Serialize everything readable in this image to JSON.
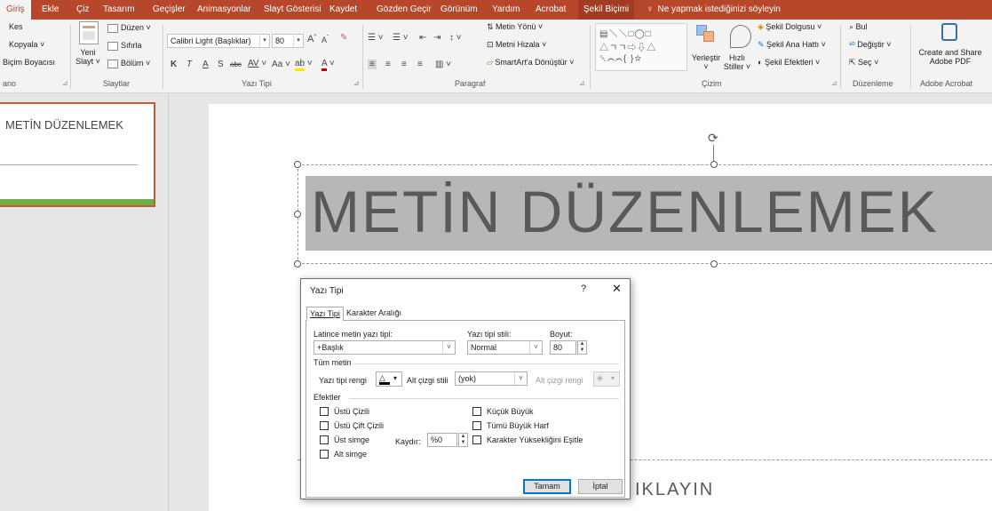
{
  "ribbon_tabs": [
    {
      "label": "Giriş",
      "active": true
    },
    {
      "label": "Ekle"
    },
    {
      "label": "Çiz"
    },
    {
      "label": "Tasarım"
    },
    {
      "label": "Geçişler"
    },
    {
      "label": "Animasyonlar"
    },
    {
      "label": "Slayt Gösterisi"
    },
    {
      "label": "Kaydet"
    },
    {
      "label": "Gözden Geçir"
    },
    {
      "label": "Görünüm"
    },
    {
      "label": "Yardım"
    },
    {
      "label": "Acrobat"
    },
    {
      "label": "Şekil Biçimi",
      "contextual": true
    }
  ],
  "tell_me": "Ne yapmak istediğinizi söyleyin",
  "clipboard": {
    "cut": "Kes",
    "copy": "Kopyala",
    "format_painter": "Biçim Boyacısı",
    "group_label": "ano"
  },
  "slides_group": {
    "new_slide_line1": "Yeni",
    "new_slide_line2": "Slayt",
    "layout": "Düzen",
    "reset": "Sıfırla",
    "section": "Bölüm",
    "group_label": "Slaytlar"
  },
  "font_group": {
    "font_name": "Calibri Light (Başlıklar)",
    "font_size": "80",
    "bold": "K",
    "italic": "T",
    "underline": "A",
    "shadow": "S",
    "strike": "abc",
    "spacing": "AV",
    "case": "Aa",
    "grow": "A",
    "shrink": "A",
    "group_label": "Yazı Tipi"
  },
  "paragraph_group": {
    "text_direction": "Metin Yönü",
    "align_text": "Metni Hizala",
    "smartart": "SmartArt'a Dönüştür",
    "group_label": "Paragraf"
  },
  "drawing_group": {
    "arrange": "Yerleştir",
    "quick_styles_line1": "Hızlı",
    "quick_styles_line2": "Stiller",
    "shape_fill": "Şekil Dolgusu",
    "shape_outline": "Şekil Ana Hattı",
    "shape_effects": "Şekil Efektleri",
    "group_label": "Çizim"
  },
  "editing_group": {
    "find": "Bul",
    "replace": "Değiştir",
    "select": "Seç",
    "group_label": "Düzenleme"
  },
  "acrobat_group": {
    "create_line1": "Create and Share",
    "create_line2": "Adobe PDF",
    "group_label": "Adobe Acrobat"
  },
  "thumbnail": {
    "title": "METİN DÜZENLEMEK"
  },
  "slide": {
    "title": "METİN DÜZENLEMEK",
    "subtitle": "IKLAYIN"
  },
  "dialog": {
    "title": "Yazı Tipi",
    "help": "?",
    "close": "✕",
    "tabs": [
      "Yazı Tipi",
      "Karakter Aralığı"
    ],
    "latin_label": "Latince metin yazı tipi:",
    "latin_value": "+Başlık",
    "style_label": "Yazı tipi stili:",
    "style_value": "Normal",
    "size_label": "Boyut:",
    "size_value": "80",
    "all_text_header": "Tüm metin",
    "font_color_label": "Yazı tipi rengi",
    "underline_style_label": "Alt çizgi stili",
    "underline_style_value": "(yok)",
    "underline_color_label": "Alt çizgi rengi",
    "effects_header": "Efektler",
    "effects_left": [
      "Üstü Çizili",
      "Üstü Çift Çizili",
      "Üst simge",
      "Alt simge"
    ],
    "effects_right": [
      "Küçük Büyük",
      "Tümü Büyük Harf",
      "Karakter Yüksekliğini Eşitle"
    ],
    "offset_label": "Kaydır:",
    "offset_value": "%0",
    "ok": "Tamam",
    "cancel": "İptal"
  },
  "colors": {
    "accent": "#b7472a",
    "slide_bar": "#70ad47",
    "highlight": "#b7b7b7"
  }
}
